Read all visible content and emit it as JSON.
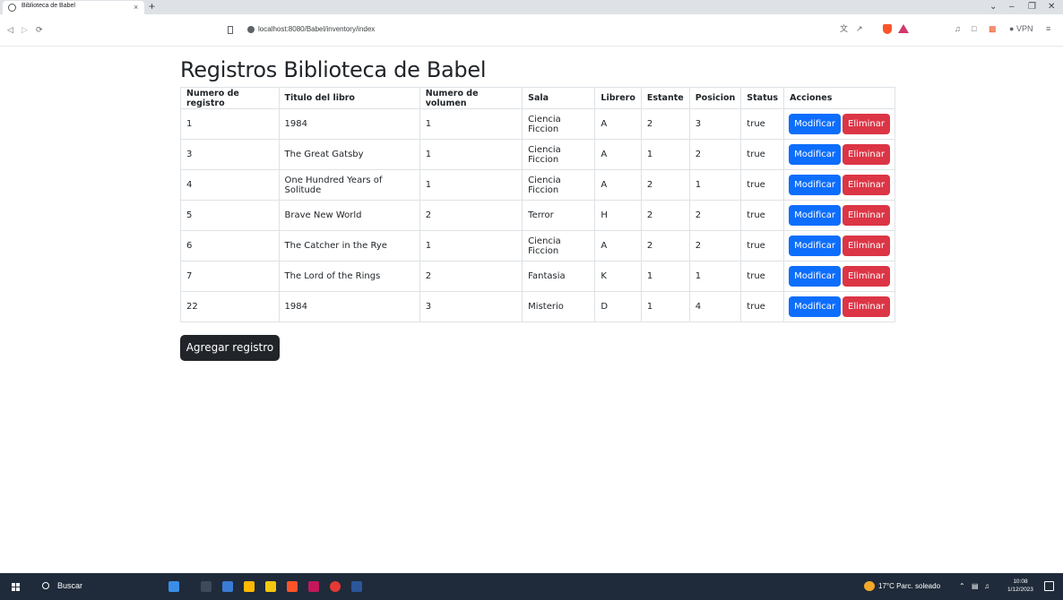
{
  "browser": {
    "tab_title": "Biblioteca de Babel",
    "tab_close": "×",
    "new_tab": "+",
    "url": "localhost:8080/Babel/inventory/index",
    "vpn_label": "VPN"
  },
  "page": {
    "title": "Registros Biblioteca de Babel",
    "add_button": "Agregar registro"
  },
  "table": {
    "headers": [
      "Numero de registro",
      "Titulo del libro",
      "Numero de volumen",
      "Sala",
      "Librero",
      "Estante",
      "Posicion",
      "Status",
      "Acciones"
    ],
    "rows": [
      {
        "id": "1",
        "title": "1984",
        "volume": "1",
        "room": "Ciencia Ficcion",
        "shelf_unit": "A",
        "shelf": "2",
        "position": "3",
        "status": "true"
      },
      {
        "id": "3",
        "title": "The Great Gatsby",
        "volume": "1",
        "room": "Ciencia Ficcion",
        "shelf_unit": "A",
        "shelf": "1",
        "position": "2",
        "status": "true"
      },
      {
        "id": "4",
        "title": "One Hundred Years of Solitude",
        "volume": "1",
        "room": "Ciencia Ficcion",
        "shelf_unit": "A",
        "shelf": "2",
        "position": "1",
        "status": "true"
      },
      {
        "id": "5",
        "title": "Brave New World",
        "volume": "2",
        "room": "Terror",
        "shelf_unit": "H",
        "shelf": "2",
        "position": "2",
        "status": "true"
      },
      {
        "id": "6",
        "title": "The Catcher in the Rye",
        "volume": "1",
        "room": "Ciencia Ficcion",
        "shelf_unit": "A",
        "shelf": "2",
        "position": "2",
        "status": "true"
      },
      {
        "id": "7",
        "title": "The Lord of the Rings",
        "volume": "2",
        "room": "Fantasia",
        "shelf_unit": "K",
        "shelf": "1",
        "position": "1",
        "status": "true"
      },
      {
        "id": "22",
        "title": "1984",
        "volume": "3",
        "room": "Misterio",
        "shelf_unit": "D",
        "shelf": "1",
        "position": "4",
        "status": "true"
      }
    ],
    "edit_label": "Modificar",
    "delete_label": "Eliminar"
  },
  "taskbar": {
    "search_label": "Buscar",
    "weather": "17°C  Parc. soleado",
    "time": "10:08",
    "date": "1/12/2023"
  },
  "colors": {
    "primary": "#0d6efd",
    "danger": "#dc3545",
    "dark": "#212529"
  }
}
